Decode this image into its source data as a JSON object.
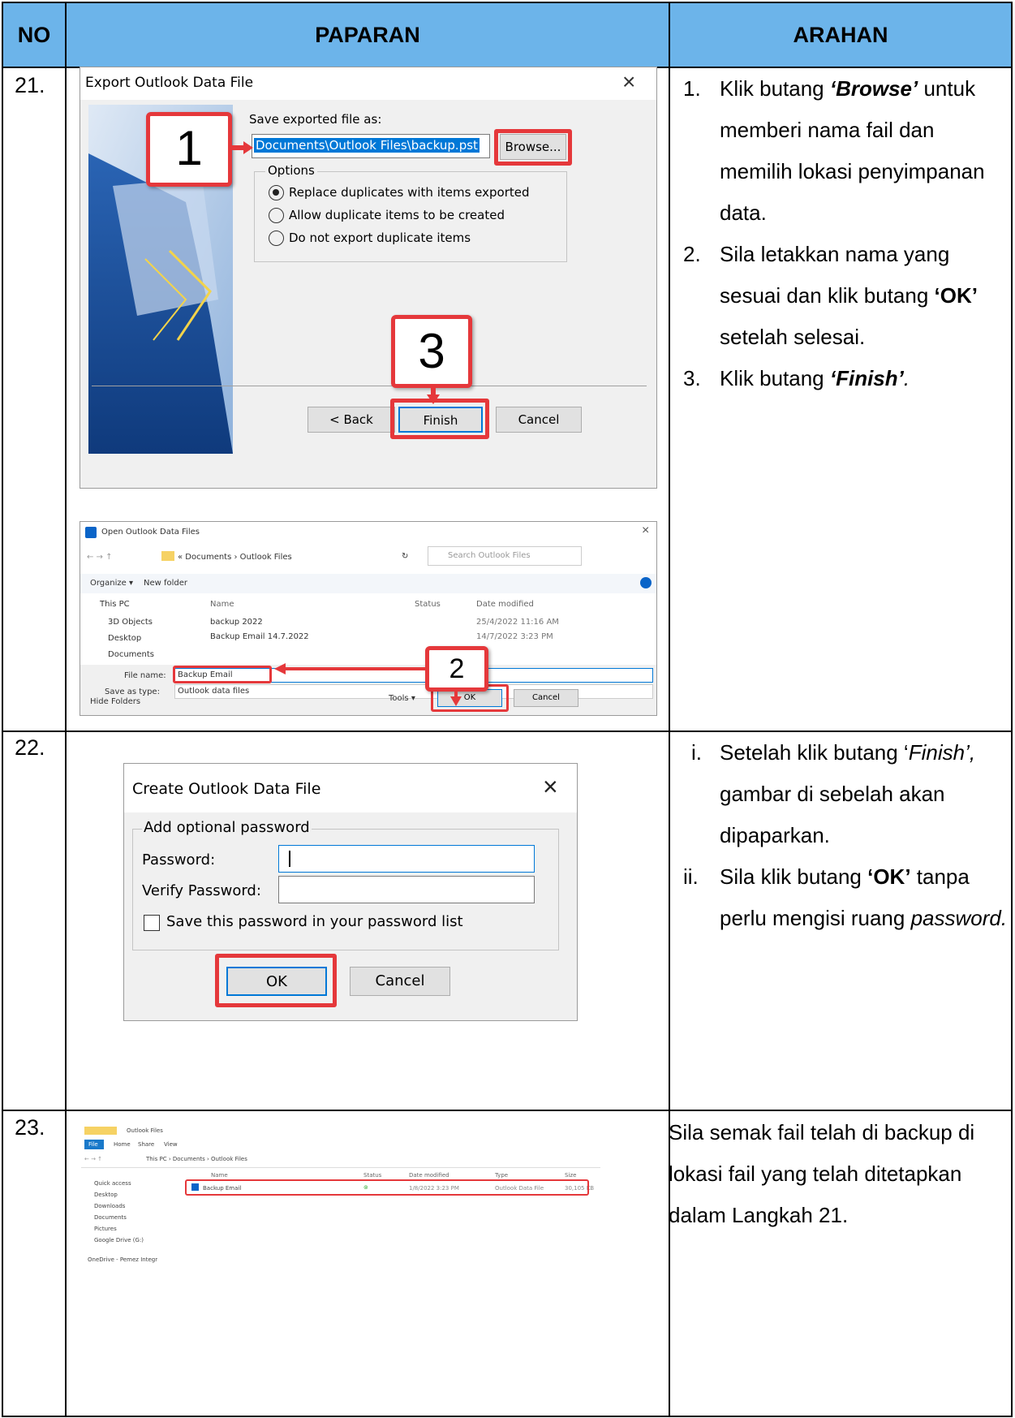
{
  "header": {
    "no": "NO",
    "paparan": "PAPARAN",
    "arahan": "ARAHAN"
  },
  "rows": [
    {
      "no": "21.",
      "export_dialog": {
        "title": "Export Outlook Data File",
        "save_label": "Save exported file as:",
        "path": "Documents\\Outlook Files\\backup.pst",
        "browse": "Browse...",
        "options_label": "Options",
        "options": [
          "Replace duplicates with items exported",
          "Allow duplicate items to be created",
          "Do not export duplicate items"
        ],
        "selected_option": 0,
        "back": "< Back",
        "finish": "Finish",
        "cancel": "Cancel"
      },
      "open_dialog": {
        "title": "Open Outlook Data Files",
        "breadcrumb": "« Documents › Outlook Files",
        "search_placeholder": "Search Outlook Files",
        "organize": "Organize ▾",
        "new_folder": "New folder",
        "nav": [
          "This PC",
          "3D Objects",
          "Desktop",
          "Documents"
        ],
        "columns": [
          "Name",
          "Status",
          "Date modified"
        ],
        "files": [
          {
            "name": "backup 2022",
            "date": "25/4/2022 11:16 AM"
          },
          {
            "name": "Backup Email 14.7.2022",
            "date": "14/7/2022 3:23 PM"
          }
        ],
        "file_name_label": "File name:",
        "file_name_value": "Backup Email",
        "save_type_label": "Save as type:",
        "save_type_value": "Outlook data files",
        "hide_folders": "Hide Folders",
        "tools": "Tools ▾",
        "ok": "OK",
        "cancel": "Cancel"
      },
      "callouts": [
        "1",
        "2",
        "3"
      ],
      "arahan": [
        {
          "n": "1.",
          "pre": "Klik butang ",
          "bold": "‘Browse’",
          "post": " untuk memberi nama fail dan memilih lokasi penyimpanan data."
        },
        {
          "n": "2.",
          "pre": "Sila letakkan nama yang sesuai dan klik butang ",
          "bold": "‘OK’",
          "post": " setelah selesai."
        },
        {
          "n": "3.",
          "pre": "Klik butang ",
          "bold": "‘Finish’",
          "post": "."
        }
      ]
    },
    {
      "no": "22.",
      "create_dialog": {
        "title": "Create Outlook Data File",
        "group_label": "Add optional password",
        "password_label": "Password:",
        "verify_label": "Verify Password:",
        "save_checkbox": "Save this password in your password list",
        "ok": "OK",
        "cancel": "Cancel"
      },
      "arahan": [
        {
          "n": "i.",
          "pre": "Setelah klik butang ‘",
          "italic": "Finish’,",
          "post": " gambar di sebelah akan dipaparkan."
        },
        {
          "n": "ii.",
          "pre": "Sila klik butang ",
          "bold": "‘OK’",
          "post": " tanpa perlu mengisi ruang ",
          "italic2": "password."
        }
      ]
    },
    {
      "no": "23.",
      "explorer": {
        "title": "Outlook Files",
        "ribbon_tabs": [
          "File",
          "Home",
          "Share",
          "View"
        ],
        "address": "This PC › Documents › Outlook Files",
        "nav": [
          "Quick access",
          "Desktop",
          "Downloads",
          "Documents",
          "Pictures",
          "Google Drive (G:)",
          "OneDrive - Pemez Integr"
        ],
        "columns": [
          "Name",
          "Status",
          "Date modified",
          "Type",
          "Size"
        ],
        "file": {
          "name": "Backup Email",
          "date": "1/8/2022 3:23 PM",
          "type": "Outlook Data File",
          "size": "30,105 KB"
        }
      },
      "arahan_text": "Sila semak fail telah di backup di lokasi fail yang telah ditetapkan dalam Langkah 21."
    }
  ]
}
